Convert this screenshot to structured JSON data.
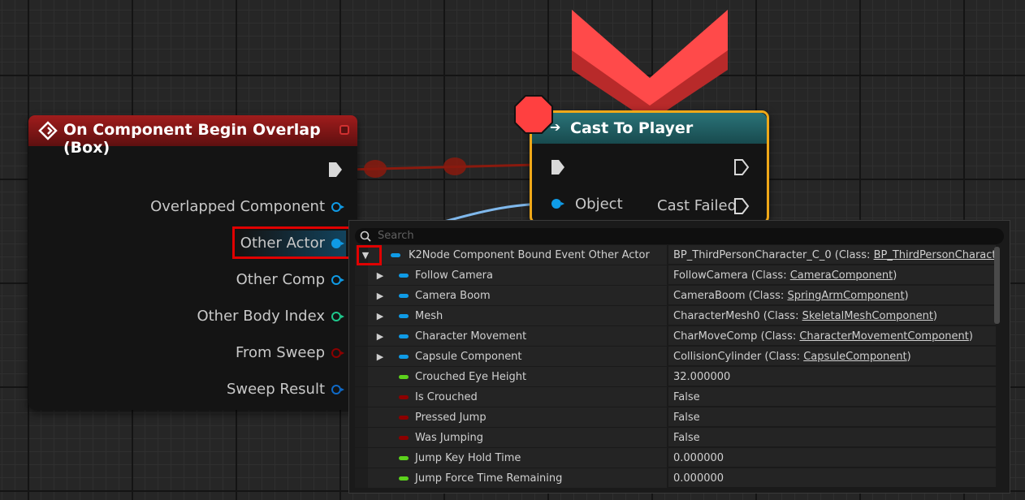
{
  "colors": {
    "exec_wire": "#8a1a0e",
    "object_wire": "#7fb8ec",
    "event_header": "#8a1616",
    "cast_header": "#1e5a5e",
    "selected_border": "#f0a818",
    "highlight_box": "#e00000",
    "breakpoint": "#ff4040",
    "bool_pin": "#8c0000",
    "float_pin": "#5cd11c",
    "object_pin": "#0f9be6",
    "int_pin": "#1ec88c"
  },
  "event_node": {
    "title": "On Component Begin Overlap (Box)",
    "pins": [
      {
        "label": "Overlapped Component",
        "type": "object"
      },
      {
        "label": "Other Actor",
        "type": "object"
      },
      {
        "label": "Other Comp",
        "type": "object"
      },
      {
        "label": "Other Body Index",
        "type": "int"
      },
      {
        "label": "From Sweep",
        "type": "bool"
      },
      {
        "label": "Sweep Result",
        "type": "struct"
      }
    ]
  },
  "cast_node": {
    "title": "Cast To Player",
    "object_label": "Object",
    "cast_failed_label": "Cast Failed"
  },
  "panel": {
    "search_placeholder": "Search",
    "rows": [
      {
        "name": "K2Node Component Bound Event Other Actor",
        "value_pre": "BP_ThirdPersonCharacter_C_0 (Class: ",
        "value_link": "BP_ThirdPersonCharacter_C",
        "value_post": "",
        "pin": "object",
        "expander": "expanded",
        "indent": 0
      },
      {
        "name": "Follow Camera",
        "value_pre": "FollowCamera (Class: ",
        "value_link": "CameraComponent",
        "value_post": ")",
        "pin": "object",
        "expander": "collapsed",
        "indent": 1
      },
      {
        "name": "Camera Boom",
        "value_pre": "CameraBoom (Class: ",
        "value_link": "SpringArmComponent",
        "value_post": ")",
        "pin": "object",
        "expander": "collapsed",
        "indent": 1
      },
      {
        "name": "Mesh",
        "value_pre": "CharacterMesh0 (Class: ",
        "value_link": "SkeletalMeshComponent",
        "value_post": ")",
        "pin": "object",
        "expander": "collapsed",
        "indent": 1
      },
      {
        "name": "Character Movement",
        "value_pre": "CharMoveComp (Class: ",
        "value_link": "CharacterMovementComponent",
        "value_post": ")",
        "pin": "object",
        "expander": "collapsed",
        "indent": 1
      },
      {
        "name": "Capsule Component",
        "value_pre": "CollisionCylinder (Class: ",
        "value_link": "CapsuleComponent",
        "value_post": ")",
        "pin": "object",
        "expander": "collapsed",
        "indent": 1
      },
      {
        "name": "Crouched Eye Height",
        "value_pre": "32.000000",
        "value_link": "",
        "value_post": "",
        "pin": "float",
        "expander": "none",
        "indent": 1
      },
      {
        "name": "Is Crouched",
        "value_pre": "False",
        "value_link": "",
        "value_post": "",
        "pin": "bool",
        "expander": "none",
        "indent": 1
      },
      {
        "name": "Pressed Jump",
        "value_pre": "False",
        "value_link": "",
        "value_post": "",
        "pin": "bool",
        "expander": "none",
        "indent": 1
      },
      {
        "name": "Was Jumping",
        "value_pre": "False",
        "value_link": "",
        "value_post": "",
        "pin": "bool",
        "expander": "none",
        "indent": 1
      },
      {
        "name": "Jump Key Hold Time",
        "value_pre": "0.000000",
        "value_link": "",
        "value_post": "",
        "pin": "float",
        "expander": "none",
        "indent": 1
      },
      {
        "name": "Jump Force Time Remaining",
        "value_pre": "0.000000",
        "value_link": "",
        "value_post": "",
        "pin": "float",
        "expander": "none",
        "indent": 1
      }
    ]
  }
}
